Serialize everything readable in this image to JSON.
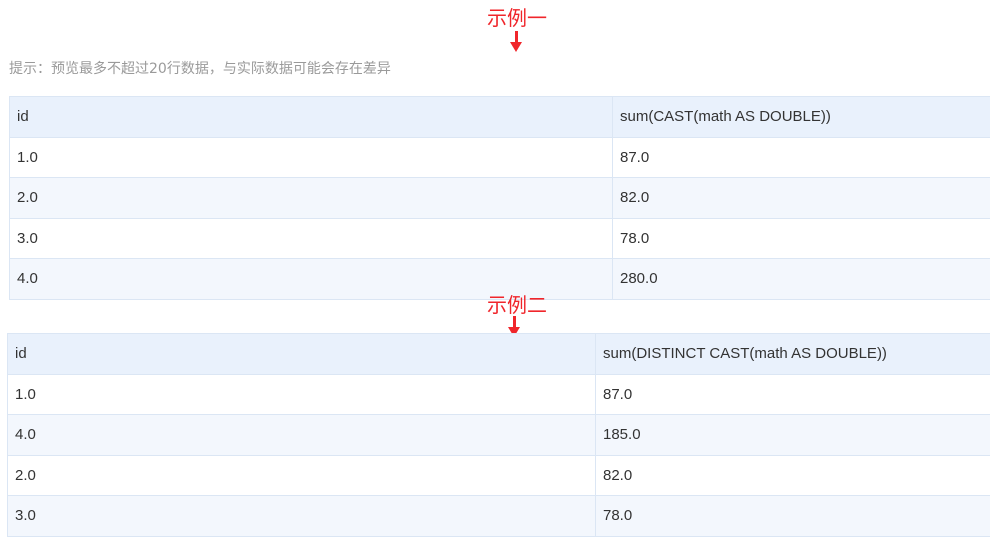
{
  "annotations": {
    "example1": "示例一",
    "example2": "示例二"
  },
  "hint": "提示：预览最多不超过20行数据，与实际数据可能会存在差异",
  "accent_color": "#f0262b",
  "table1": {
    "headers": [
      "id",
      "sum(CAST(math AS DOUBLE))"
    ],
    "rows": [
      [
        "1.0",
        "87.0"
      ],
      [
        "2.0",
        "82.0"
      ],
      [
        "3.0",
        "78.0"
      ],
      [
        "4.0",
        "280.0"
      ]
    ]
  },
  "table2": {
    "headers": [
      "id",
      "sum(DISTINCT CAST(math AS DOUBLE))"
    ],
    "rows": [
      [
        "1.0",
        "87.0"
      ],
      [
        "4.0",
        "185.0"
      ],
      [
        "2.0",
        "82.0"
      ],
      [
        "3.0",
        "78.0"
      ]
    ]
  }
}
